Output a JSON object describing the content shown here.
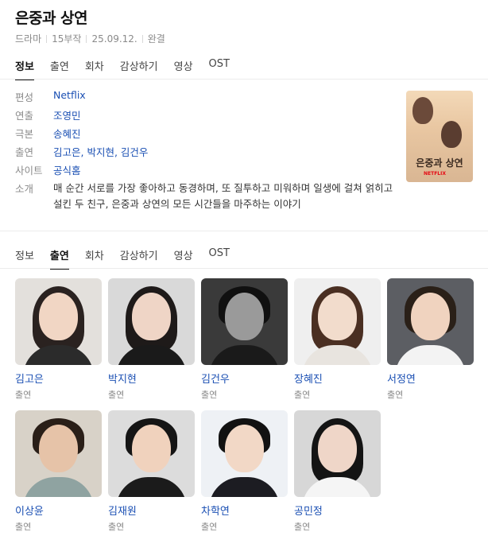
{
  "title": "은중과 상연",
  "meta": {
    "genre": "드라마",
    "episodes": "15부작",
    "date": "25.09.12.",
    "status": "완결"
  },
  "tabs_top": [
    "정보",
    "출연",
    "회차",
    "감상하기",
    "영상",
    "OST"
  ],
  "tabs_cast": [
    "정보",
    "출연",
    "회차",
    "감상하기",
    "영상",
    "OST"
  ],
  "info": {
    "network_label": "편성",
    "network": "Netflix",
    "director_label": "연출",
    "director": "조영민",
    "writer_label": "극본",
    "writer": "송혜진",
    "cast_label": "출연",
    "cast": "김고은, 박지현, 김건우",
    "site_label": "사이트",
    "site": "공식홈",
    "synopsis_label": "소개",
    "synopsis": "매 순간 서로를 가장 좋아하고 동경하며, 또 질투하고 미워하며 일생에 걸쳐 얽히고설킨 두 친구, 은중과 상연의 모든 시간들을 마주하는 이야기"
  },
  "poster": {
    "title": "은중과 상연",
    "brand": "NETFLIX"
  },
  "cast_cards": [
    {
      "name": "김고은",
      "role": "출연"
    },
    {
      "name": "박지현",
      "role": "출연"
    },
    {
      "name": "김건우",
      "role": "출연"
    },
    {
      "name": "장혜진",
      "role": "출연"
    },
    {
      "name": "서정연",
      "role": "출연"
    },
    {
      "name": "이상윤",
      "role": "출연"
    },
    {
      "name": "김재원",
      "role": "출연"
    },
    {
      "name": "차학연",
      "role": "출연"
    },
    {
      "name": "공민정",
      "role": "출연"
    }
  ]
}
